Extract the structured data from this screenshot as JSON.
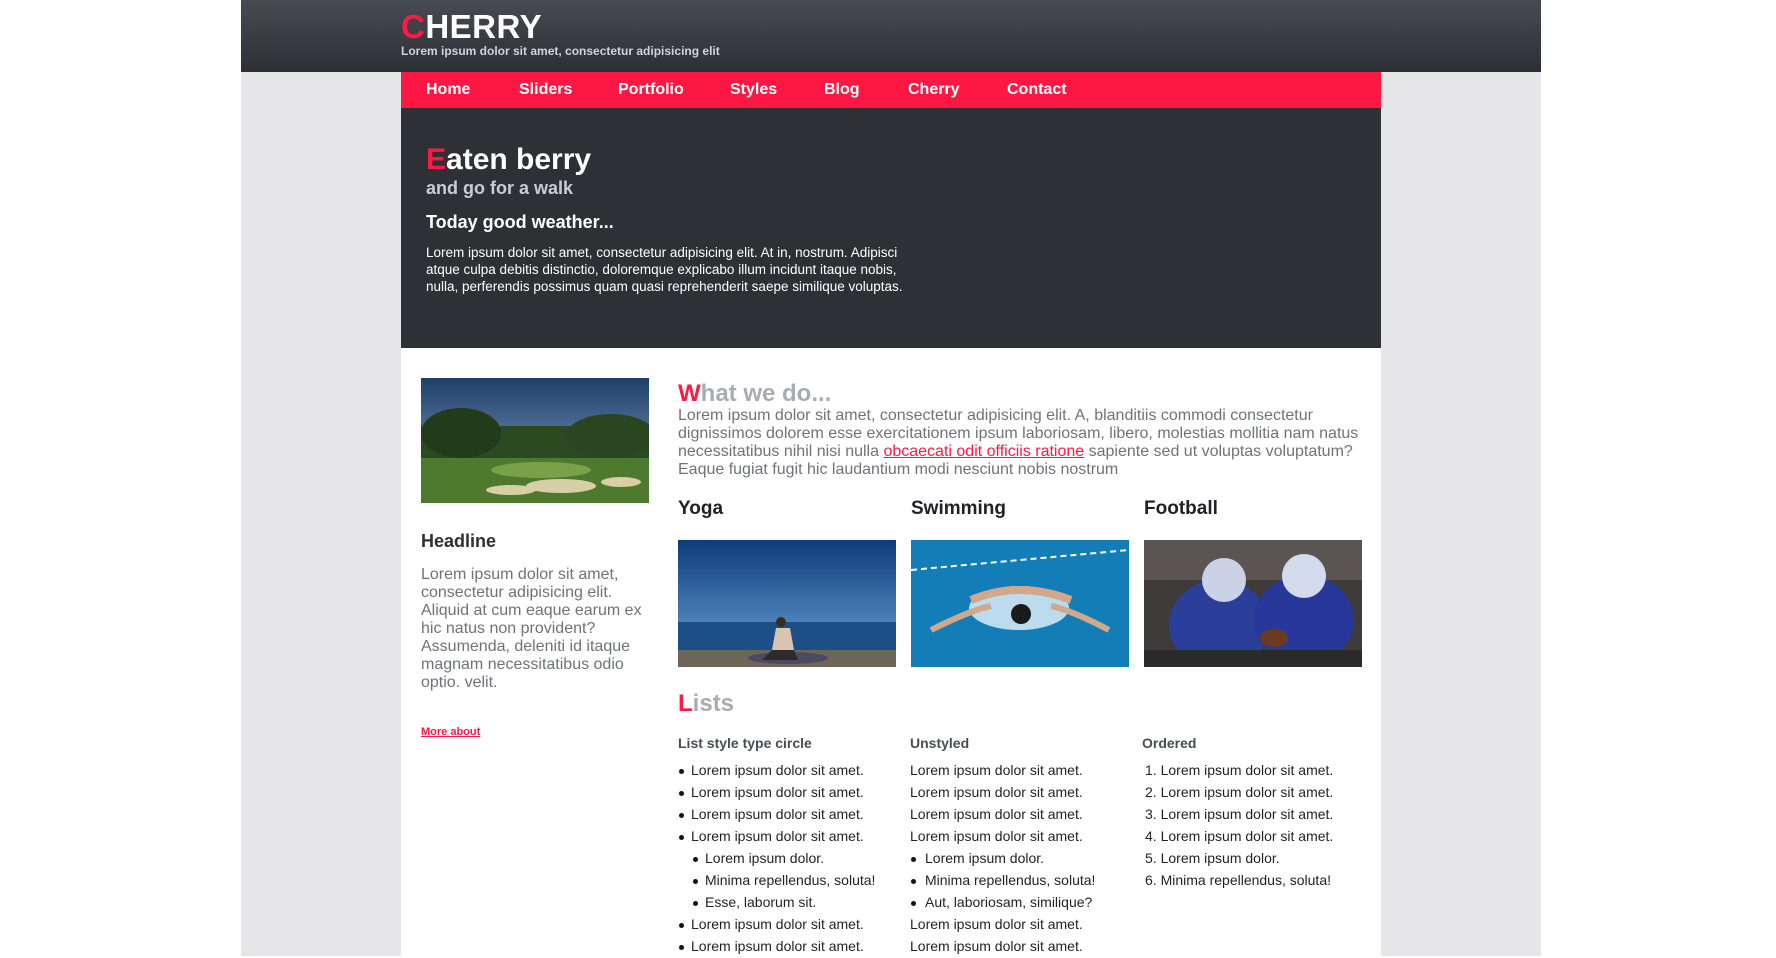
{
  "header": {
    "logo_first": "C",
    "logo_rest": "HERRY",
    "tagline": "Lorem ipsum dolor sit amet, consectetur adipisicing elit"
  },
  "nav": [
    "Home",
    "Sliders",
    "Portfolio",
    "Styles",
    "Blog",
    "Cherry",
    "Contact"
  ],
  "hero": {
    "title_first": "E",
    "title_rest": "aten berry",
    "subtitle": "and go for a walk",
    "heading": "Today good weather...",
    "text": "Lorem ipsum dolor sit amet, consectetur adipisicing elit. At in, nostrum. Adipisci atque culpa debitis distinctio, doloremque explicabo illum incidunt itaque nobis, nulla, perferendis possimus quam quasi reprehenderit saepe similique voluptas."
  },
  "sidebar": {
    "headline": "Headline",
    "text": "Lorem ipsum dolor sit amet, consectetur adipisicing elit. Aliquid at cum eaque earum ex hic natus non provident? Assumenda, deleniti id itaque magnam necessitatibus odio optio. velit.",
    "link": "More about"
  },
  "what": {
    "title_first": "W",
    "title_rest": "hat we do...",
    "text_before": "Lorem ipsum dolor sit amet, consectetur adipisicing elit. A, blanditiis commodi consectetur dignissimos dolorem esse exercitationem ipsum laboriosam, libero, molestias mollitia nam natus necessitatibus nihil nisi nulla ",
    "link": "obcaecati odit officiis ratione",
    "text_after": " sapiente sed ut voluptas voluptatum? Eaque fugiat fugit hic laudantium modi nesciunt nobis nostrum"
  },
  "sports": [
    "Yoga",
    "Swimming",
    "Football"
  ],
  "lists": {
    "title_first": "L",
    "title_rest": "ists",
    "circle": {
      "heading": "List style type circle",
      "items": [
        "Lorem ipsum dolor sit amet.",
        "Lorem ipsum dolor sit amet.",
        "Lorem ipsum dolor sit amet.",
        "Lorem ipsum dolor sit amet."
      ],
      "sub_items": [
        "Lorem ipsum dolor.",
        "Minima repellendus, soluta!",
        "Esse, laborum sit."
      ],
      "items_after": [
        "Lorem ipsum dolor sit amet.",
        "Lorem ipsum dolor sit amet."
      ]
    },
    "unstyled": {
      "heading": "Unstyled",
      "items": [
        "Lorem ipsum dolor sit amet.",
        "Lorem ipsum dolor sit amet.",
        "Lorem ipsum dolor sit amet.",
        "Lorem ipsum dolor sit amet."
      ],
      "sub_items": [
        "Lorem ipsum dolor.",
        "Minima repellendus, soluta!",
        "Aut, laboriosam, similique?"
      ],
      "items_after": [
        "Lorem ipsum dolor sit amet.",
        "Lorem ipsum dolor sit amet."
      ]
    },
    "ordered": {
      "heading": "Ordered",
      "numbers": [
        "1.",
        "2.",
        "3.",
        "4.",
        "5.",
        "6."
      ],
      "items": [
        "Lorem ipsum dolor sit amet.",
        "Lorem ipsum dolor sit amet.",
        "Lorem ipsum dolor sit amet.",
        "Lorem ipsum dolor sit amet.",
        "Lorem ipsum dolor.",
        "Minima repellendus, soluta!"
      ]
    }
  },
  "colors": {
    "accent": "#ff1744",
    "dark": "#2e3036",
    "muted": "#a8acb3"
  }
}
